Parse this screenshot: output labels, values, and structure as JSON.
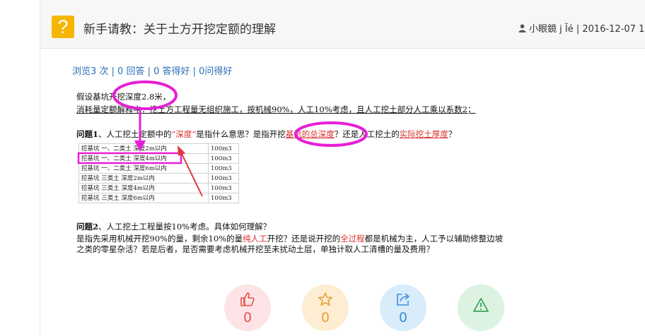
{
  "header": {
    "icon_glyph": "?",
    "icon_name": "question-icon",
    "title": "新手请教：关于土方开挖定额的理解",
    "author": "小眼鏡 j Ïé",
    "separator": "|",
    "date": "2016-12-07 1"
  },
  "stats": {
    "text": "浏览3 次 | 0 回答 | 0 答得好 | 0问得好"
  },
  "body": {
    "line1": "假设基坑开挖深度2.8米，",
    "line2": "消耗量定额解释中：挖土方工程量无组织施工，按机械90%，人工10%考虑，且人工挖土部分人工乘以系数2；",
    "q1": {
      "label": "问题1",
      "t1": "、人工挖土定额中的",
      "depth": "“深度”",
      "t2": "是指什么意思？是指开挖",
      "pit_depth": "基坑的总深度",
      "t3": "？还是人工挖土的",
      "actual_depth": "实际挖土厚度",
      "t4": "？"
    },
    "table": [
      {
        "name": "挖基坑 一、二类土 深度2m以内",
        "unit": "100m3"
      },
      {
        "name": "挖基坑 一、二类土 深度4m以内",
        "unit": "100m3"
      },
      {
        "name": "挖基坑 一、二类土 深度6m以内",
        "unit": "100m3"
      },
      {
        "name": "挖基坑 三类土 深度2m以内",
        "unit": "100m3"
      },
      {
        "name": "挖基坑 三类土 深度4m以内",
        "unit": "100m3"
      },
      {
        "name": "挖基坑 三类土 深度6m以内",
        "unit": "100m3"
      }
    ],
    "q2": {
      "label": "问题2",
      "title": "、人工挖土工程量按10%考虑。具体如何理解？",
      "l1a": "是指先采用机械开挖90%的量，剩余10%的量",
      "manual": "纯人工",
      "l1b": "开挖？还是说开挖的",
      "whole": "全过程",
      "l1c": "都是机械为主，人工予以辅助修整边坡",
      "l2": "之类的零星杂活？若是后者，是否需要考虑机械开挖至未扰动土层，单独计取人工清槽的量及费用？"
    }
  },
  "reactions": [
    {
      "name": "like",
      "icon": "thumbs-up-icon",
      "count": "0",
      "bg": "#fde3e6",
      "fg": "#e2544f"
    },
    {
      "name": "favorite",
      "icon": "star-icon",
      "count": "0",
      "bg": "#fdedd2",
      "fg": "#e7a13a"
    },
    {
      "name": "share",
      "icon": "share-icon",
      "count": "0",
      "bg": "#d8ecfa",
      "fg": "#3d8fd6"
    },
    {
      "name": "report",
      "icon": "warning-icon",
      "count": "",
      "bg": "#dcf3e2",
      "fg": "#3aa656"
    }
  ],
  "colors": {
    "annotation_magenta": "#e61fd6",
    "highlight_red": "#d9302c",
    "link_blue": "#2a6fb5",
    "icon_yellow": "#f6b600"
  }
}
